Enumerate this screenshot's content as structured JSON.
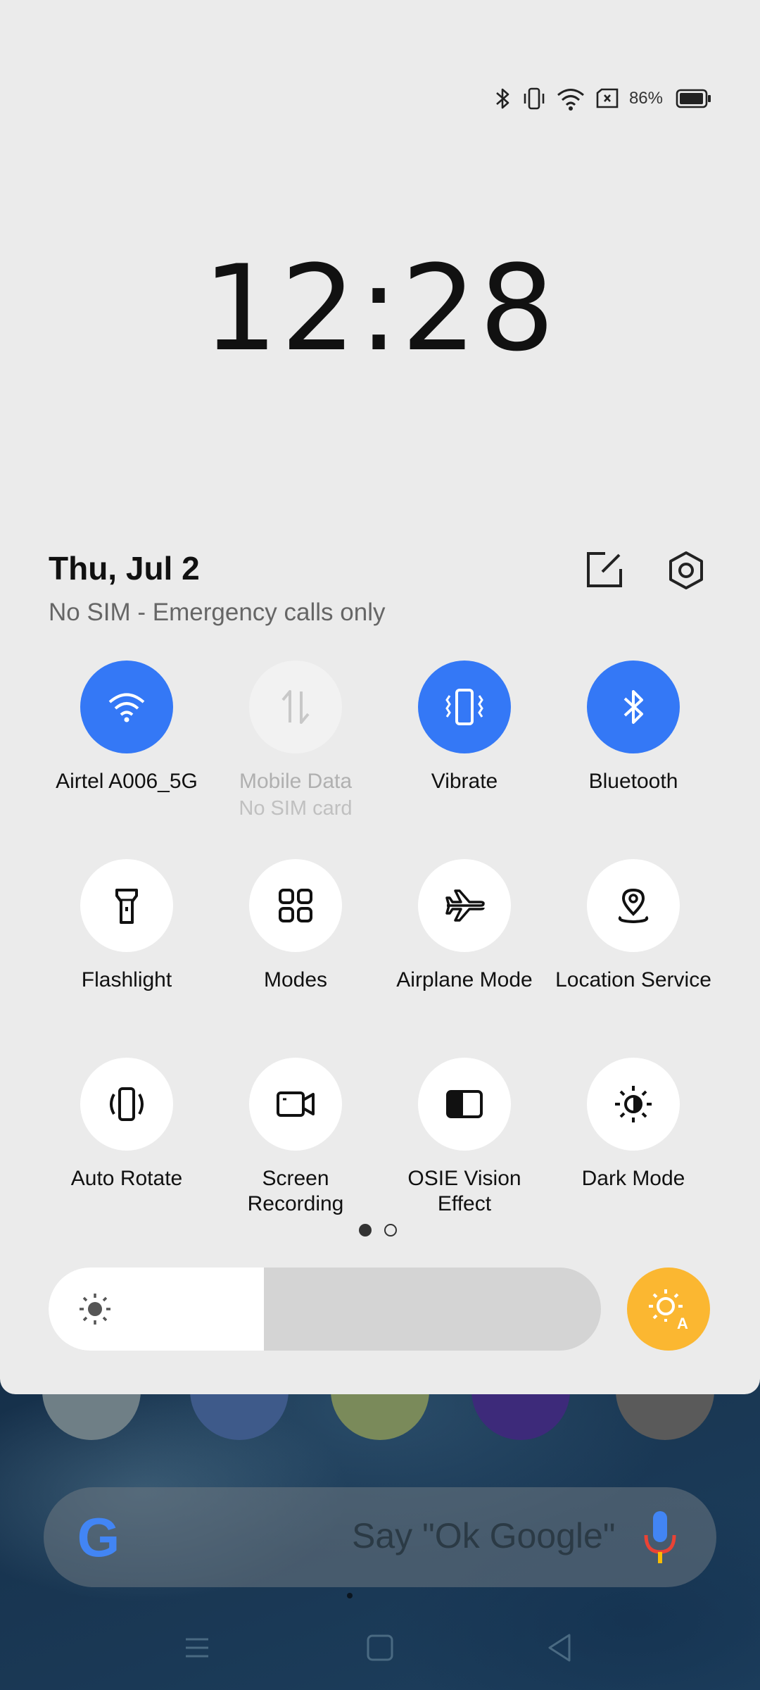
{
  "status_bar": {
    "battery_percent": "86%"
  },
  "clock": {
    "time": "12:28"
  },
  "header": {
    "date": "Thu, Jul 2",
    "sim_status": "No SIM - Emergency calls only"
  },
  "tiles": {
    "wifi": {
      "label": "Airtel A006_5G",
      "state": "on"
    },
    "mobile_data": {
      "label": "Mobile Data",
      "sublabel": "No SIM card",
      "state": "disabled"
    },
    "vibrate": {
      "label": "Vibrate",
      "state": "on"
    },
    "bluetooth": {
      "label": "Bluetooth",
      "state": "on"
    },
    "flashlight": {
      "label": "Flashlight",
      "state": "off"
    },
    "modes": {
      "label": "Modes",
      "state": "off"
    },
    "airplane": {
      "label": "Airplane Mode",
      "state": "off"
    },
    "location": {
      "label": "Location Service",
      "state": "off"
    },
    "auto_rotate": {
      "label": "Auto Rotate",
      "state": "off"
    },
    "screen_recording": {
      "label": "Screen Recording",
      "state": "off"
    },
    "osie": {
      "label": "OSIE Vision Effect",
      "state": "off"
    },
    "dark_mode": {
      "label": "Dark Mode",
      "state": "off"
    }
  },
  "pager": {
    "current_page": 1,
    "total_pages": 2
  },
  "brightness": {
    "level": 0.39,
    "auto": true
  },
  "home": {
    "search_placeholder": "Say \"Ok Google\""
  },
  "colors": {
    "accent": "#3478f6",
    "auto_brightness": "#fbb731",
    "panel": "#ebebeb"
  }
}
